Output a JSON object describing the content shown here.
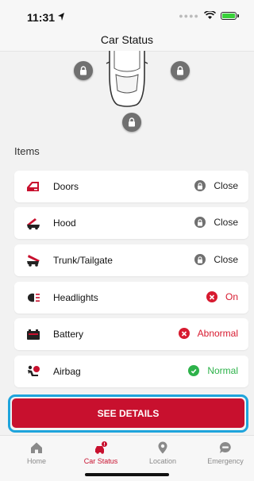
{
  "status_bar": {
    "time": "11:31"
  },
  "header": {
    "title": "Car Status"
  },
  "items_heading": "Items",
  "items": [
    {
      "label": "Doors",
      "status": "Close",
      "state": "locked"
    },
    {
      "label": "Hood",
      "status": "Close",
      "state": "locked"
    },
    {
      "label": "Trunk/Tailgate",
      "status": "Close",
      "state": "locked"
    },
    {
      "label": "Headlights",
      "status": "On",
      "state": "error"
    },
    {
      "label": "Battery",
      "status": "Abnormal",
      "state": "error"
    },
    {
      "label": "Airbag",
      "status": "Normal",
      "state": "ok"
    }
  ],
  "see_details_label": "SEE DETAILS",
  "tabs": [
    {
      "label": "Home",
      "icon": "home-icon"
    },
    {
      "label": "Car Status",
      "icon": "car-alert-icon",
      "active": true
    },
    {
      "label": "Location",
      "icon": "location-pin-icon"
    },
    {
      "label": "Emergency",
      "icon": "sos-icon"
    }
  ],
  "colors": {
    "accent": "#c8102e",
    "lock_gray": "#707070",
    "error_red": "#d71a2f",
    "ok_green": "#2db24a",
    "focus_ring": "#1ea4dc"
  }
}
